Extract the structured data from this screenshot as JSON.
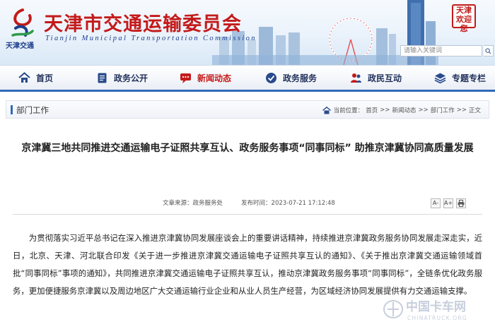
{
  "header": {
    "title": "天津市交通运输委员会",
    "subtitle": "Tianjin Municipal Transportation Commission",
    "logo_text": "天津交通",
    "seal_text": "天津欢迎您",
    "search_placeholder": "请输入关键词",
    "colors": {
      "title": "#c41a1a",
      "brand_blue": "#1c3f8c",
      "accent": "#2f6ab8"
    }
  },
  "nav": {
    "items": [
      {
        "label": "首页",
        "icon": "home-icon"
      },
      {
        "label": "政务公开",
        "icon": "document-icon"
      },
      {
        "label": "新闻动态",
        "icon": "chat-bubble-icon",
        "active": true
      },
      {
        "label": "政务服务",
        "icon": "service-icon"
      },
      {
        "label": "政民互动",
        "icon": "users-icon"
      },
      {
        "label": "专题专栏",
        "icon": "layers-icon"
      }
    ]
  },
  "breadcrumb": {
    "section": "部门工作",
    "prefix": "当前位置：",
    "items": [
      "首页",
      ">>",
      "新闻动态",
      ">>",
      "部门工作",
      ">>",
      "正文"
    ]
  },
  "article": {
    "title": "京津冀三地共同推进交通运输电子证照共享互认、政务服务事项“同事同标” 助推京津冀协同高质量发展",
    "source_label": "文章来源：",
    "source": "政务服务处",
    "published_label": "发布时间：",
    "published": "2023-07-21 17:12:48",
    "font_tools": [
      "A-",
      "A+",
      "print"
    ],
    "body": "为贯彻落实习近平总书记在深入推进京津冀协同发展座谈会上的重要讲话精神，持续推进京津冀政务服务协同发展走深走实，近日，北京、天津、河北联合印发《关于进一步推进京津冀交通运输电子证照共享互认的通知》、《关于推出京津冀交通运输领域首批“同事同标”事项的通知》，共同推进京津冀交通运输电子证照共享互认，推动京津冀政务服务事项“同事同标”，全链条优化政务服务，更加便捷服务京津冀以及周边地区广大交通运输行业企业和从业人员生产经营，为区域经济协同发展提供有力交通运输支撑。"
  },
  "watermark": {
    "text_cn": "中国卡车网",
    "text_en": "CHINATRUCK.ORG"
  }
}
